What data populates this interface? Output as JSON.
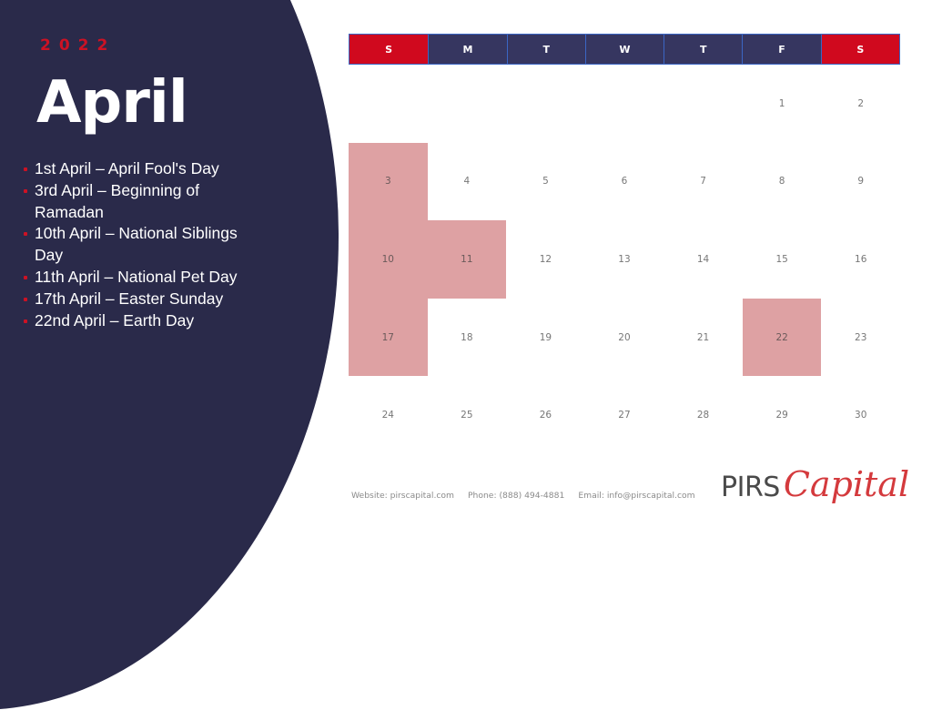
{
  "header": {
    "year": "2022",
    "month": "April"
  },
  "events": [
    "1st April – April Fool's Day",
    "3rd April – Beginning of Ramadan",
    "10th April – National Siblings Day",
    "11th April – National Pet Day",
    "17th April – Easter Sunday",
    "22nd April – Earth Day"
  ],
  "calendar": {
    "weekdays": [
      "S",
      "M",
      "T",
      "W",
      "T",
      "F",
      "S"
    ],
    "weekend_color": "#d0091e",
    "weekday_color": "#363660",
    "highlight_color": "#dea1a3",
    "first_weekday_index": 5,
    "days_in_month": 30,
    "highlighted_days": [
      3,
      10,
      11,
      17,
      22
    ]
  },
  "footer": {
    "website": "Website: pirscapital.com",
    "phone": "Phone: (888) 494-4881",
    "email": "Email: info@pirscapital.com"
  },
  "brand": {
    "part1": "PIRS",
    "part2": "Capital"
  }
}
